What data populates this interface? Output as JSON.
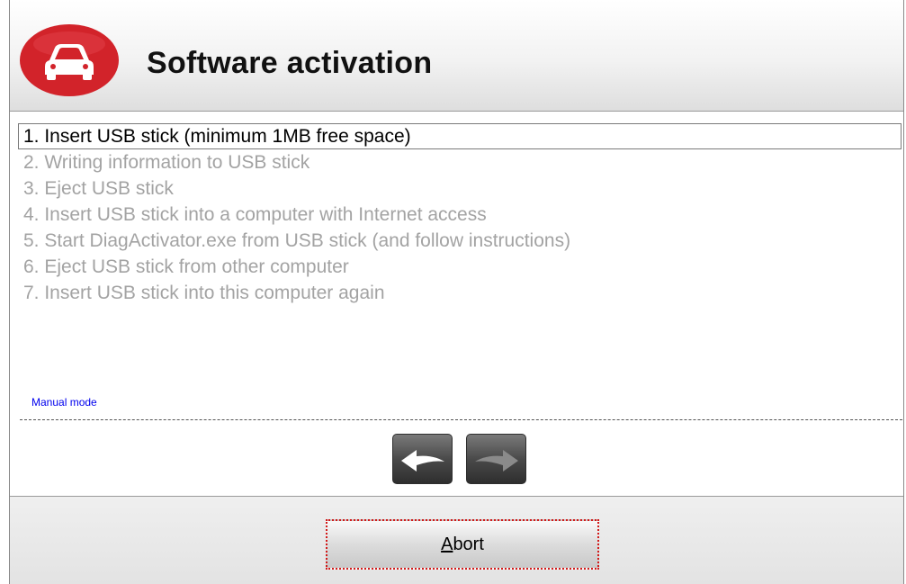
{
  "header": {
    "title": "Software activation",
    "icon": "car-icon",
    "accent_color": "#d2232a"
  },
  "steps": [
    {
      "label": "1. Insert USB stick (minimum 1MB free space)",
      "state": "active"
    },
    {
      "label": "2. Writing information to USB stick",
      "state": "pending"
    },
    {
      "label": "3. Eject USB stick",
      "state": "pending"
    },
    {
      "label": "4. Insert USB stick into a computer with Internet access",
      "state": "pending"
    },
    {
      "label": "5. Start DiagActivator.exe from USB stick (and follow instructions)",
      "state": "pending"
    },
    {
      "label": "6. Eject USB stick from other computer",
      "state": "pending"
    },
    {
      "label": "7. Insert USB stick into this computer again",
      "state": "pending"
    }
  ],
  "manual_mode": {
    "label": "Manual mode"
  },
  "navigation": {
    "back_icon": "arrow-left-icon",
    "forward_icon": "arrow-right-icon",
    "forward_enabled": false
  },
  "footer": {
    "abort_mnemonic": "A",
    "abort_rest": "bort"
  }
}
